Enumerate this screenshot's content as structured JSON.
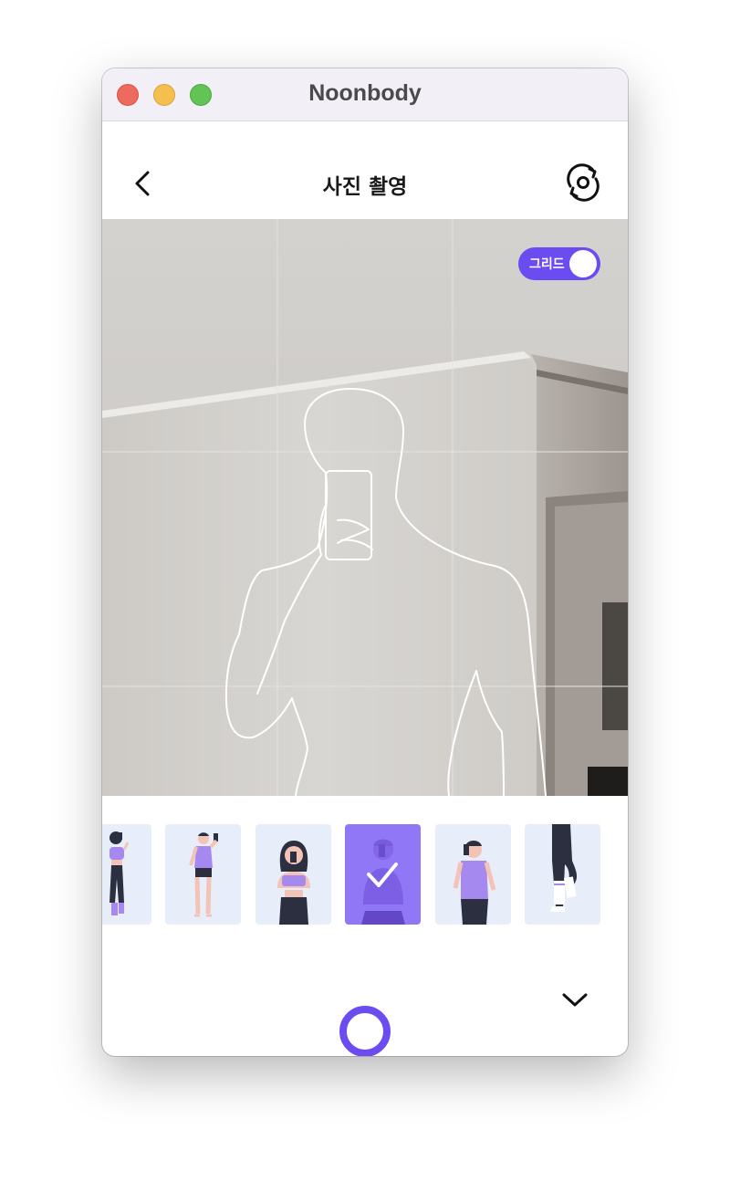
{
  "window": {
    "title": "Noonbody"
  },
  "header": {
    "title": "사진 촬영"
  },
  "camera": {
    "grid_toggle": {
      "label": "그리드",
      "on": true
    }
  },
  "poses": {
    "items": [
      {
        "name": "pose-female-mirror-side",
        "selected": false
      },
      {
        "name": "pose-male-mirror-full",
        "selected": false
      },
      {
        "name": "pose-female-mirror-upper",
        "selected": false
      },
      {
        "name": "pose-male-mirror-upper",
        "selected": true
      },
      {
        "name": "pose-male-mirror-side",
        "selected": false
      },
      {
        "name": "pose-legs",
        "selected": false
      }
    ]
  },
  "colors": {
    "accent": "#6a4cf0",
    "selected_thumb": "#9077f6",
    "thumb_bg": "#e7eef9",
    "titlebar": "#f3eff6"
  },
  "icons": {
    "back": "chevron-left-icon",
    "rotate_camera": "rotate-camera-icon",
    "collapse": "chevron-down-icon",
    "shutter": "shutter-button"
  }
}
